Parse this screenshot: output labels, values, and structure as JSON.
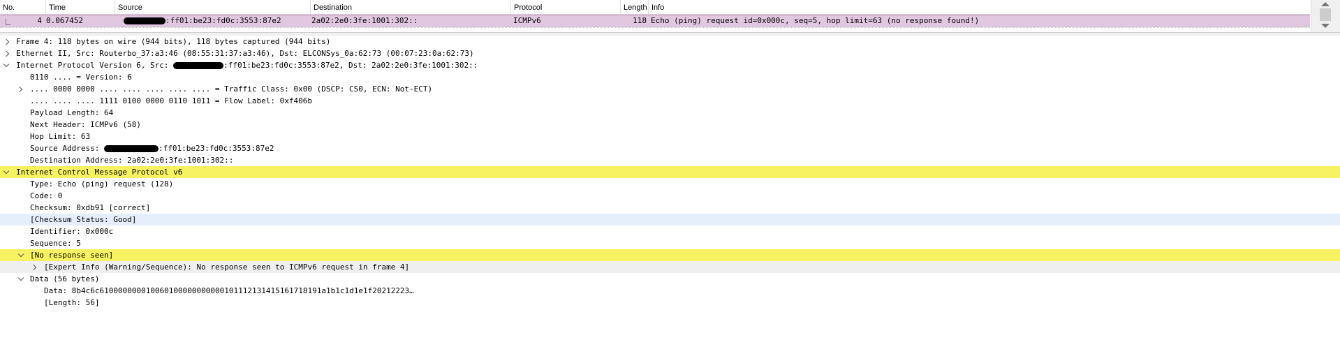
{
  "packet_list": {
    "columns": [
      "No.",
      "Time",
      "Source",
      "Destination",
      "Protocol",
      "Length",
      "Info"
    ],
    "row": {
      "no": "4",
      "time": "0.067452",
      "source_visible": ":ff01:be23:fd0c:3553:87e2",
      "destination": "2a02:2e0:3fe:1001:302::",
      "protocol": "ICMPv6",
      "length": "118",
      "info": "Echo (ping) request id=0x000c, seq=5, hop limit=63 (no response found!)"
    },
    "row_color": "#e2c7e1"
  },
  "details": {
    "frame": "Frame 4: 118 bytes on wire (944 bits), 118 bytes captured (944 bits)",
    "ethernet": "Ethernet II, Src: Routerbo_37:a3:46 (08:55:31:37:a3:46), Dst: ELCONSys_0a:62:73 (00:07:23:0a:62:73)",
    "ipv6_prefix": "Internet Protocol Version 6, Src: ",
    "ipv6_suffix": ":ff01:be23:fd0c:3553:87e2, Dst: 2a02:2e0:3fe:1001:302::",
    "version": "0110 .... = Version: 6",
    "traffic_class": ".... 0000 0000 .... .... .... .... .... = Traffic Class: 0x00 (DSCP: CS0, ECN: Not-ECT)",
    "flow_label": ".... .... .... 1111 0100 0000 0110 1011 = Flow Label: 0xf406b",
    "payload_length": "Payload Length: 64",
    "next_header": "Next Header: ICMPv6 (58)",
    "hop_limit": "Hop Limit: 63",
    "src_addr_prefix": "Source Address: ",
    "src_addr_suffix": ":ff01:be23:fd0c:3553:87e2",
    "dst_addr": "Destination Address: 2a02:2e0:3fe:1001:302::",
    "icmpv6": "Internet Control Message Protocol v6",
    "type": "Type: Echo (ping) request (128)",
    "code": "Code: 0",
    "checksum": "Checksum: 0xdb91 [correct]",
    "checksum_status": "[Checksum Status: Good]",
    "identifier": "Identifier: 0x000c",
    "sequence": "Sequence: 5",
    "no_response": "[No response seen]",
    "expert_info": "[Expert Info (Warning/Sequence): No response seen to ICMPv6 request in frame 4]",
    "data_header": "Data (56 bytes)",
    "data_value": "Data: 8b4c6c610000000010060100000000000101112131415161718191a1b1c1d1e1f20212223…",
    "data_length": "[Length: 56]"
  },
  "colors": {
    "highlight_yellow": "#f6f262",
    "highlight_blue": "#e5effb",
    "highlight_gray": "#efefef"
  },
  "icons": [
    "chevron-right-icon",
    "chevron-down-icon",
    "scroll-up-icon",
    "scroll-down-icon"
  ]
}
